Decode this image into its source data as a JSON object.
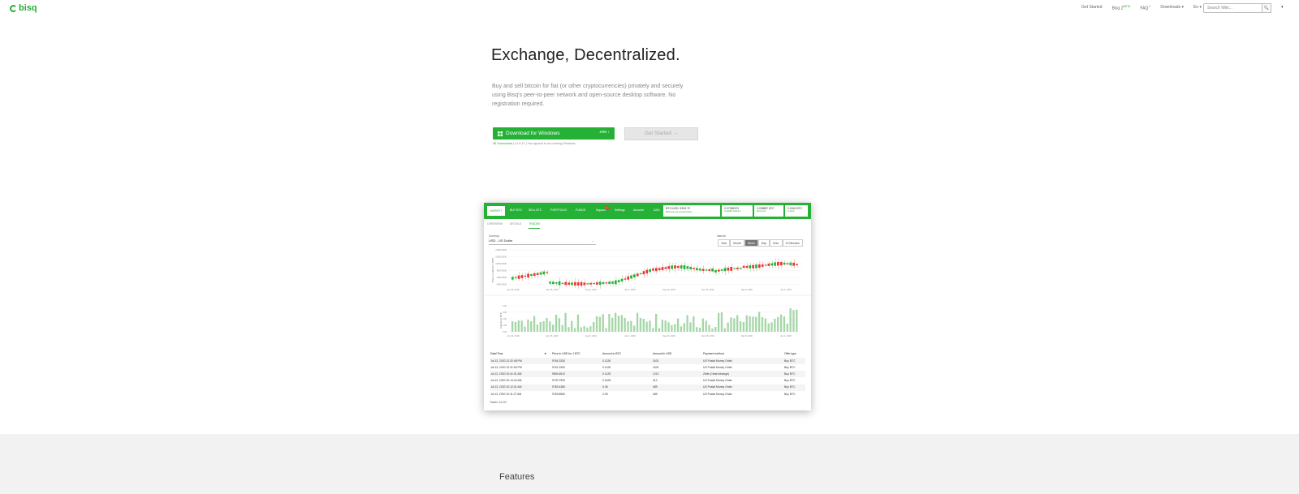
{
  "nav": {
    "brand": "bisq",
    "links": [
      {
        "label": "Get Started"
      },
      {
        "label": "Bisq 2",
        "sup": "BETA"
      },
      {
        "label": "FAQ",
        "sup": "↗"
      },
      {
        "label": "Downloads ▾"
      },
      {
        "label": "En ▾"
      }
    ],
    "search_placeholder": "Search Wiki...",
    "search_button": "🔍",
    "lang_icon": "◐"
  },
  "hero": {
    "title": "Exchange, Decentralized.",
    "description": "Buy and sell bitcoin for fiat (or other cryptocurrencies) privately and securely using Bisq's peer-to-peer network and open-source desktop software. No registration required.",
    "download_label": "Download for Windows",
    "download_ext": ".exe ↓",
    "get_started_label": "Get Started  →",
    "sub_all": "All Downloads",
    "sub_version": "v1.9.17",
    "sub_note": "You appear to be running Windows",
    "sep": "|"
  },
  "app": {
    "tabs": [
      "MARKET",
      "BUY BTC",
      "SELL BTC",
      "PORTFOLIO",
      "FUNDS",
      "Support",
      "Settings",
      "Account",
      "DAO"
    ],
    "support_badge": "1",
    "market_price": "BTC/USD: 9263.70",
    "market_sub": "Bitstamp via priceProvider",
    "balances": [
      {
        "value": "0.07356223",
        "label": "Available balance"
      },
      {
        "value": "0.038887 BTC",
        "label": "Reserved"
      },
      {
        "value": "0.0040 BTC",
        "label": "Locked"
      }
    ],
    "subtabs": [
      "OVERVIEW",
      "DETAILS",
      "TRADES"
    ],
    "currency_label": "Currency",
    "currency_value": "USD - US Dollar",
    "currency_chev": "⌄",
    "interval_label": "Interval",
    "intervals": [
      "Year",
      "Month",
      "Week",
      "Day",
      "Hour",
      "10 Minutes"
    ],
    "price_axis_label": "Price in USD for 1 BTC",
    "volume_axis_label": "Volume in BTC",
    "price_y_ticks": [
      "14000.0000",
      "12000.0000",
      "10000.0000",
      "8000.0000",
      "6000.0000",
      "4000.0000"
    ],
    "volume_y_ticks": [
      "4.00",
      "3.00",
      "2.00",
      "1.00",
      "0.00"
    ],
    "x_ticks": [
      "Jun 22, 2018",
      "Jan 15, 2019",
      "Aug 5, 2019",
      "Jan 1, 2020",
      "Sep 20, 2019",
      "Dec 15, 2019",
      "Mar 8, 2020",
      "Jun 1, 2020"
    ],
    "trade_headers": [
      "Date/Time",
      "▼",
      "Price in USD for 1 BTC",
      "Amount in BTC",
      "Amount in USD",
      "Payment method",
      "Offer type"
    ],
    "trades": [
      [
        "Jul 13, 2020 12:32:48 PM",
        "9764.3330",
        "0.1126",
        "1100",
        "US Postal Money Order",
        "Buy BTC"
      ],
      [
        "Jul 13, 2020 12:31:53 PM",
        "9761.3300",
        "0.1126",
        "1100",
        "US Postal Money Order",
        "Buy BTC"
      ],
      [
        "Jul 13, 2020 10:41:01 AM",
        "9694.6512",
        "0.1125",
        "1212",
        "Zelle (ClearXchange)",
        "Buy BTC"
      ],
      [
        "Jul 13, 2020 10:14:40 AM",
        "9709.7500",
        "0.0425",
        "412",
        "US Postal Money Order",
        "Buy BTC"
      ],
      [
        "Jul 13, 2020 10:12:01 AM",
        "9783.4380",
        "0.05",
        "489",
        "US Postal Money Order",
        "Buy BTC"
      ],
      [
        "Jul 13, 2020 10:11:27 AM",
        "9783.8550",
        "0.05",
        "489",
        "US Postal Money Order",
        "Buy BTC"
      ]
    ],
    "trades_count": "Trades: 24,247",
    "colors": {
      "green": "#25b135",
      "red": "#e53935",
      "volume": "#a5d6a7"
    }
  },
  "features": {
    "title": "Features"
  }
}
